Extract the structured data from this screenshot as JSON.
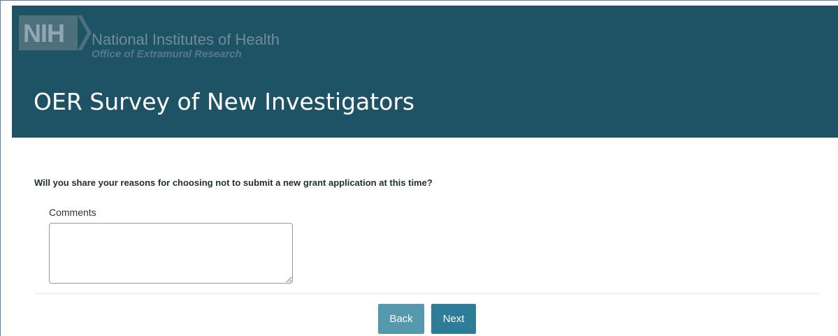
{
  "header": {
    "logo_text": "NIH",
    "org_name": "National Institutes of Health",
    "org_subtitle": "Office of Extramural Research",
    "page_title": "OER Survey of New Investigators",
    "colors": {
      "header_bg": "#1e5366",
      "title_text": "#ffffff"
    }
  },
  "form": {
    "question": "Will you share your reasons for choosing not to submit a new grant application at this time?",
    "comments_label": "Comments",
    "comments_value": ""
  },
  "buttons": {
    "back_label": "Back",
    "next_label": "Next",
    "colors": {
      "back": "#5599ae",
      "next": "#2d7c98"
    }
  },
  "icons": {
    "logo": "nih-chevron-logo"
  }
}
